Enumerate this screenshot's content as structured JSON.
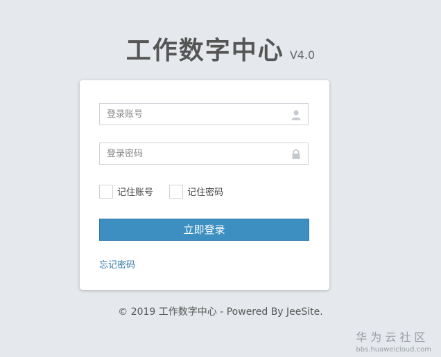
{
  "header": {
    "title": "工作数字中心",
    "version": "V4.0"
  },
  "login": {
    "account_placeholder": "登录账号",
    "password_placeholder": "登录密码",
    "remember_account": "记住账号",
    "remember_password": "记住密码",
    "login_button": "立即登录",
    "forgot_link": "忘记密码",
    "account_icon": "user-icon",
    "password_icon": "lock-icon"
  },
  "footer": {
    "copyright": "© 2019 工作数字中心 - Powered By JeeSite."
  },
  "watermark": {
    "brand": "华为云社区",
    "url": "bbs.huaweicloud.com"
  },
  "colors": {
    "background": "#e5e8ec",
    "button": "#3d8fc2",
    "link": "#3479a8"
  }
}
